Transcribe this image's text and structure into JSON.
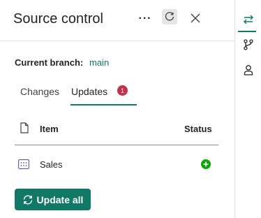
{
  "header": {
    "title": "Source control",
    "more_label": "···"
  },
  "branch": {
    "label": "Current branch:",
    "name": "main"
  },
  "tabs": [
    {
      "label": "Changes",
      "active": false
    },
    {
      "label": "Updates",
      "active": true,
      "badge": "1"
    }
  ],
  "table": {
    "columns": [
      "Item",
      "Status"
    ],
    "rows": [
      {
        "name": "Sales",
        "icon": "semantic-model-icon",
        "status": "added"
      }
    ]
  },
  "actions": {
    "update_all": "Update all"
  },
  "rail": {
    "items": [
      "source-control-icon",
      "branch-icon",
      "user-icon"
    ]
  },
  "colors": {
    "accent": "#117865",
    "badge": "#c4314b",
    "status_added": "#13a10e"
  }
}
